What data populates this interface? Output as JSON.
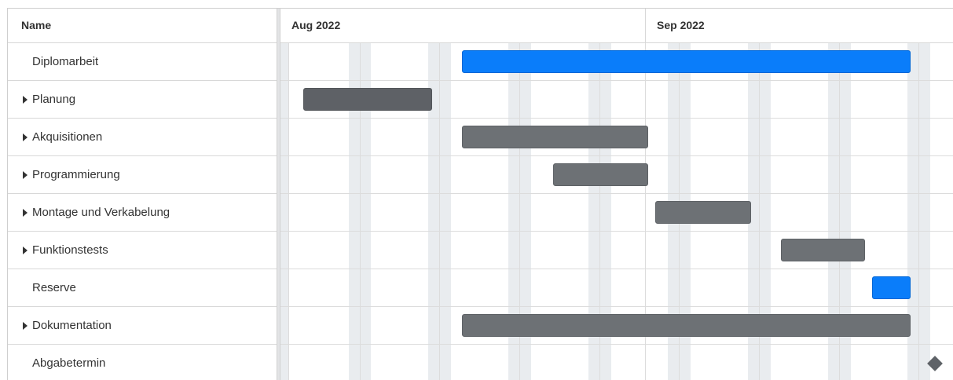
{
  "grid": {
    "name_header": "Name",
    "rows": [
      {
        "label": "Diplomarbeit",
        "expandable": false
      },
      {
        "label": "Planung",
        "expandable": true
      },
      {
        "label": "Akquisitionen",
        "expandable": true
      },
      {
        "label": "Programmierung",
        "expandable": true
      },
      {
        "label": "Montage und Verkabelung",
        "expandable": true
      },
      {
        "label": "Funktionstests",
        "expandable": true
      },
      {
        "label": "Reserve",
        "expandable": false
      },
      {
        "label": "Dokumentation",
        "expandable": true
      },
      {
        "label": "Abgabetermin",
        "expandable": false
      }
    ]
  },
  "timeline": {
    "months": [
      "Aug 2022",
      "Sep 2022"
    ]
  },
  "colors": {
    "task_bar": "#0a7dfa",
    "group_bar": "#6d7175",
    "milestone": "#5f6368",
    "weekend": "#e9ecef"
  },
  "icons": {
    "expand": "caret-right-icon",
    "milestone": "diamond-icon"
  }
}
